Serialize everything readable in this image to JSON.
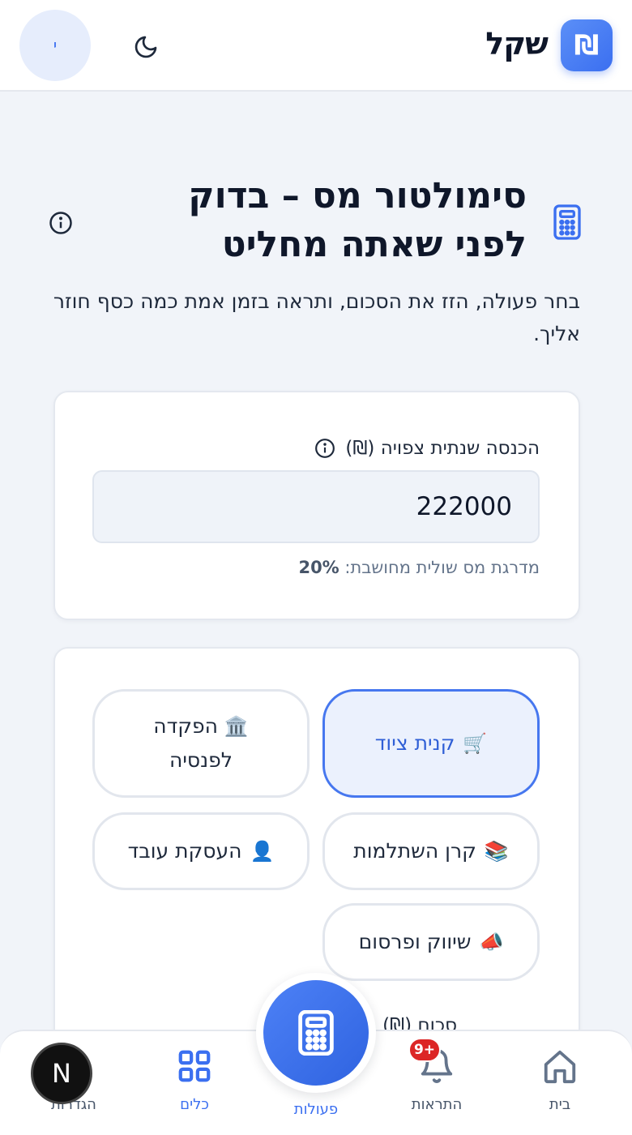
{
  "header": {
    "logo_symbol": "₪",
    "app_name": "שקל",
    "avatar_initial": "י"
  },
  "page": {
    "title": "סימולטור מס – בדוק לפני שאתה מחליט",
    "subtitle": "בחר פעולה, הזז את הסכום, ותראה בזמן אמת כמה כסף חוזר אליך."
  },
  "income": {
    "label": "הכנסה שנתית צפויה (₪)",
    "value": "222000",
    "bracket_label": "מדרגת מס שולית מחושבת:",
    "bracket_value": "20%"
  },
  "actions": [
    {
      "icon": "🛒",
      "label": "קנית ציוד",
      "selected": true
    },
    {
      "icon": "🏛️",
      "label": "הפקדה לפנסיה",
      "selected": false
    },
    {
      "icon": "📚",
      "label": "קרן השתלמות",
      "selected": false
    },
    {
      "icon": "👤",
      "label": "העסקת עובד",
      "selected": false
    },
    {
      "icon": "📣",
      "label": "שיווק ופרסום",
      "selected": false
    }
  ],
  "amount_label_partial": "סכום (₪)",
  "nav": {
    "home": "בית",
    "alerts": "התראות",
    "alerts_badge": "+9",
    "actions": "פעולות",
    "tools": "כלים",
    "settings": "הגדרות"
  },
  "dev_badge": "N",
  "colors": {
    "accent": "#3b6ff0",
    "badge": "#dc2626"
  }
}
